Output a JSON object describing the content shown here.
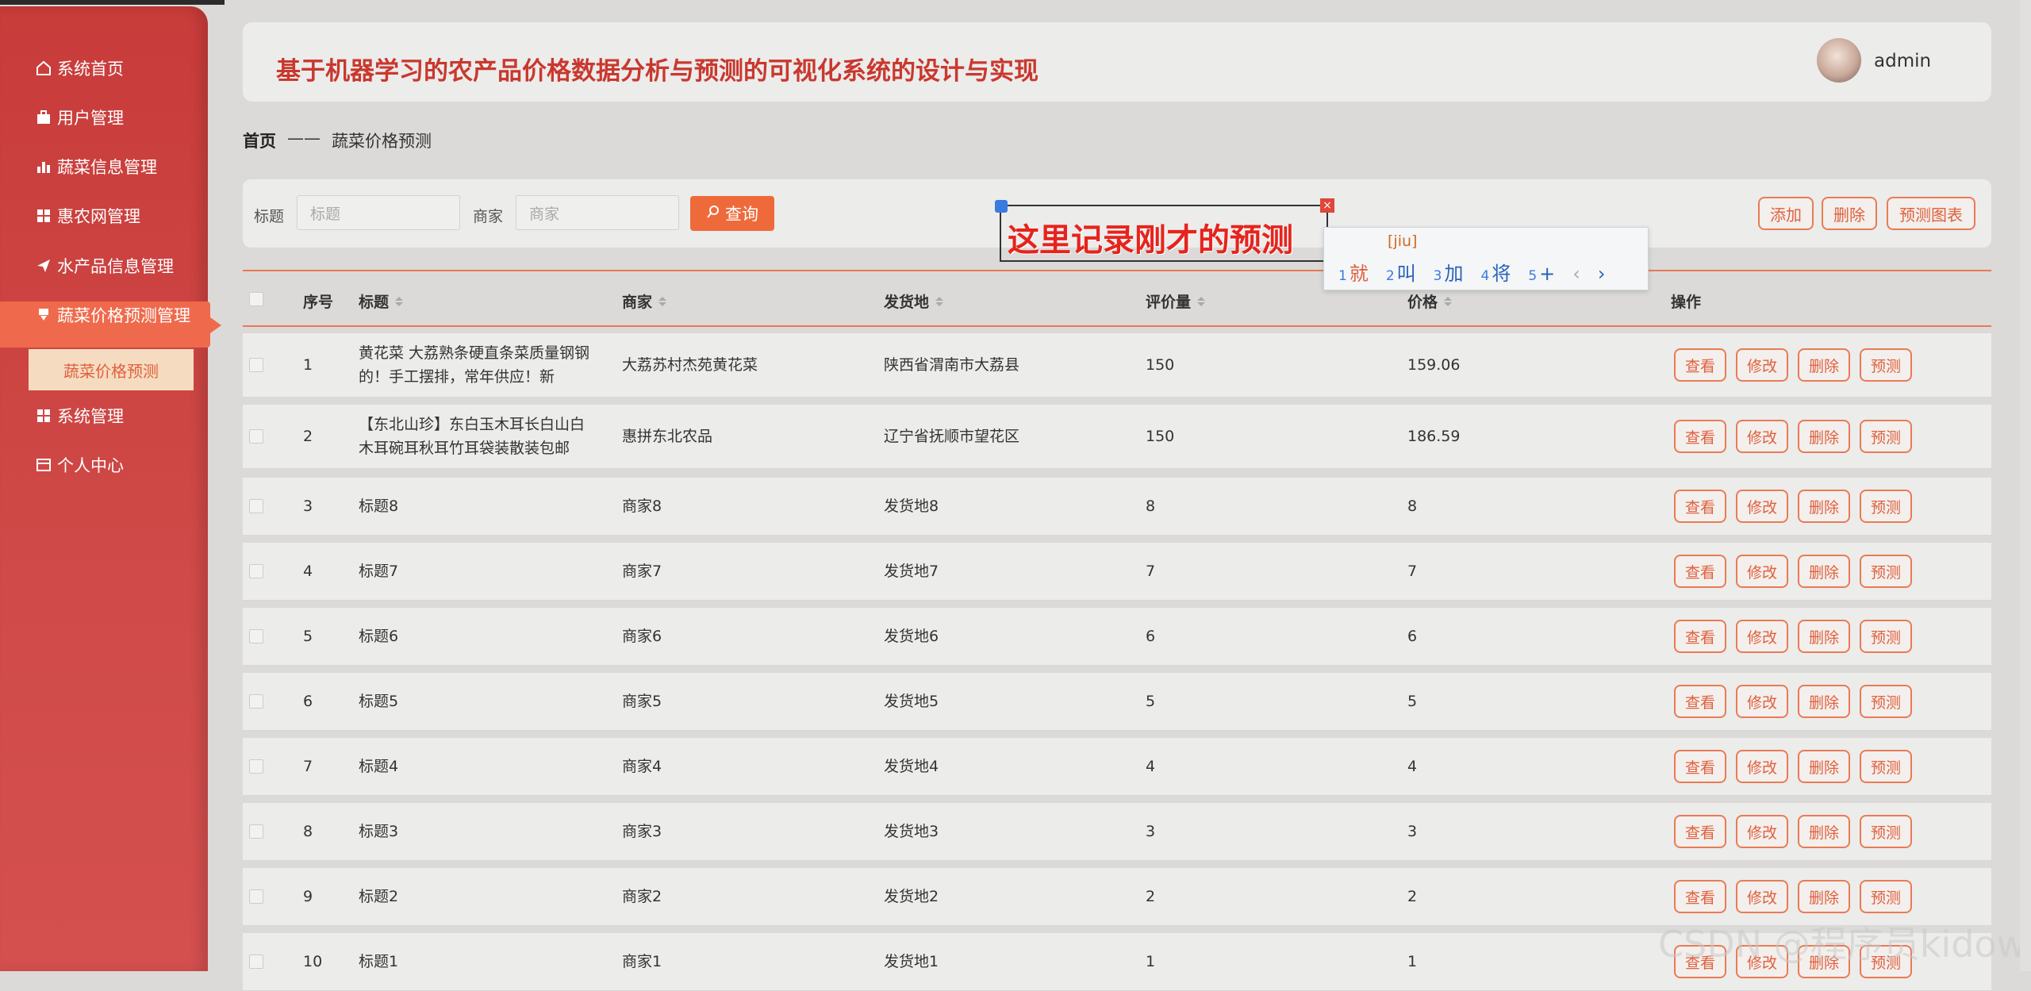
{
  "sidebar": {
    "items": [
      {
        "label": "系统首页",
        "icon": "home-icon"
      },
      {
        "label": "用户管理",
        "icon": "briefcase-icon"
      },
      {
        "label": "蔬菜信息管理",
        "icon": "bar-chart-icon"
      },
      {
        "label": "惠农网管理",
        "icon": "grid-icon"
      },
      {
        "label": "水产品信息管理",
        "icon": "paper-plane-icon"
      },
      {
        "label": "蔬菜价格预测管理",
        "icon": "download-icon"
      },
      {
        "label": "系统管理",
        "icon": "grid-icon"
      },
      {
        "label": "个人中心",
        "icon": "id-card-icon"
      }
    ],
    "submenu_active": "蔬菜价格预测"
  },
  "header": {
    "title": "基于机器学习的农产品价格数据分析与预测的可视化系统的设计与实现",
    "username": "admin"
  },
  "breadcrumb": {
    "home": "首页",
    "sep": "——",
    "current": "蔬菜价格预测"
  },
  "search": {
    "title_label": "标题",
    "title_placeholder": "标题",
    "merchant_label": "商家",
    "merchant_placeholder": "商家",
    "query_button": "查询",
    "add_button": "添加",
    "delete_button": "删除",
    "chart_button": "预测图表"
  },
  "annotation": {
    "text": "这里记录刚才的预测",
    "ime_pinyin": "[jiu]",
    "ime_candidates": [
      "就",
      "叫",
      "加",
      "将",
      "+"
    ]
  },
  "table": {
    "headers": {
      "index": "序号",
      "title": "标题",
      "merchant": "商家",
      "origin": "发货地",
      "reviews": "评价量",
      "price": "价格",
      "actions": "操作"
    },
    "action_labels": {
      "view": "查看",
      "edit": "修改",
      "delete": "删除",
      "predict": "预测"
    },
    "rows": [
      {
        "index": "1",
        "title": "黄花菜 大荔熟条硬直条菜质量钢钢的！手工摆排，常年供应！新",
        "merchant": "大荔苏村杰苑黄花菜",
        "origin": "陕西省渭南市大荔县",
        "reviews": "150",
        "price": "159.06"
      },
      {
        "index": "2",
        "title": "【东北山珍】东白玉木耳长白山白木耳碗耳秋耳竹耳袋装散装包邮",
        "merchant": "惠拼东北农品",
        "origin": "辽宁省抚顺市望花区",
        "reviews": "150",
        "price": "186.59"
      },
      {
        "index": "3",
        "title": "标题8",
        "merchant": "商家8",
        "origin": "发货地8",
        "reviews": "8",
        "price": "8"
      },
      {
        "index": "4",
        "title": "标题7",
        "merchant": "商家7",
        "origin": "发货地7",
        "reviews": "7",
        "price": "7"
      },
      {
        "index": "5",
        "title": "标题6",
        "merchant": "商家6",
        "origin": "发货地6",
        "reviews": "6",
        "price": "6"
      },
      {
        "index": "6",
        "title": "标题5",
        "merchant": "商家5",
        "origin": "发货地5",
        "reviews": "5",
        "price": "5"
      },
      {
        "index": "7",
        "title": "标题4",
        "merchant": "商家4",
        "origin": "发货地4",
        "reviews": "4",
        "price": "4"
      },
      {
        "index": "8",
        "title": "标题3",
        "merchant": "商家3",
        "origin": "发货地3",
        "reviews": "3",
        "price": "3"
      },
      {
        "index": "9",
        "title": "标题2",
        "merchant": "商家2",
        "origin": "发货地2",
        "reviews": "2",
        "price": "2"
      },
      {
        "index": "10",
        "title": "标题1",
        "merchant": "商家1",
        "origin": "发货地1",
        "reviews": "1",
        "price": "1"
      }
    ]
  },
  "watermark": "CSDN @程序员kidow",
  "colors": {
    "accent": "#ef6a3a",
    "sidebar": "#cf4a48",
    "title": "#c9382e"
  }
}
